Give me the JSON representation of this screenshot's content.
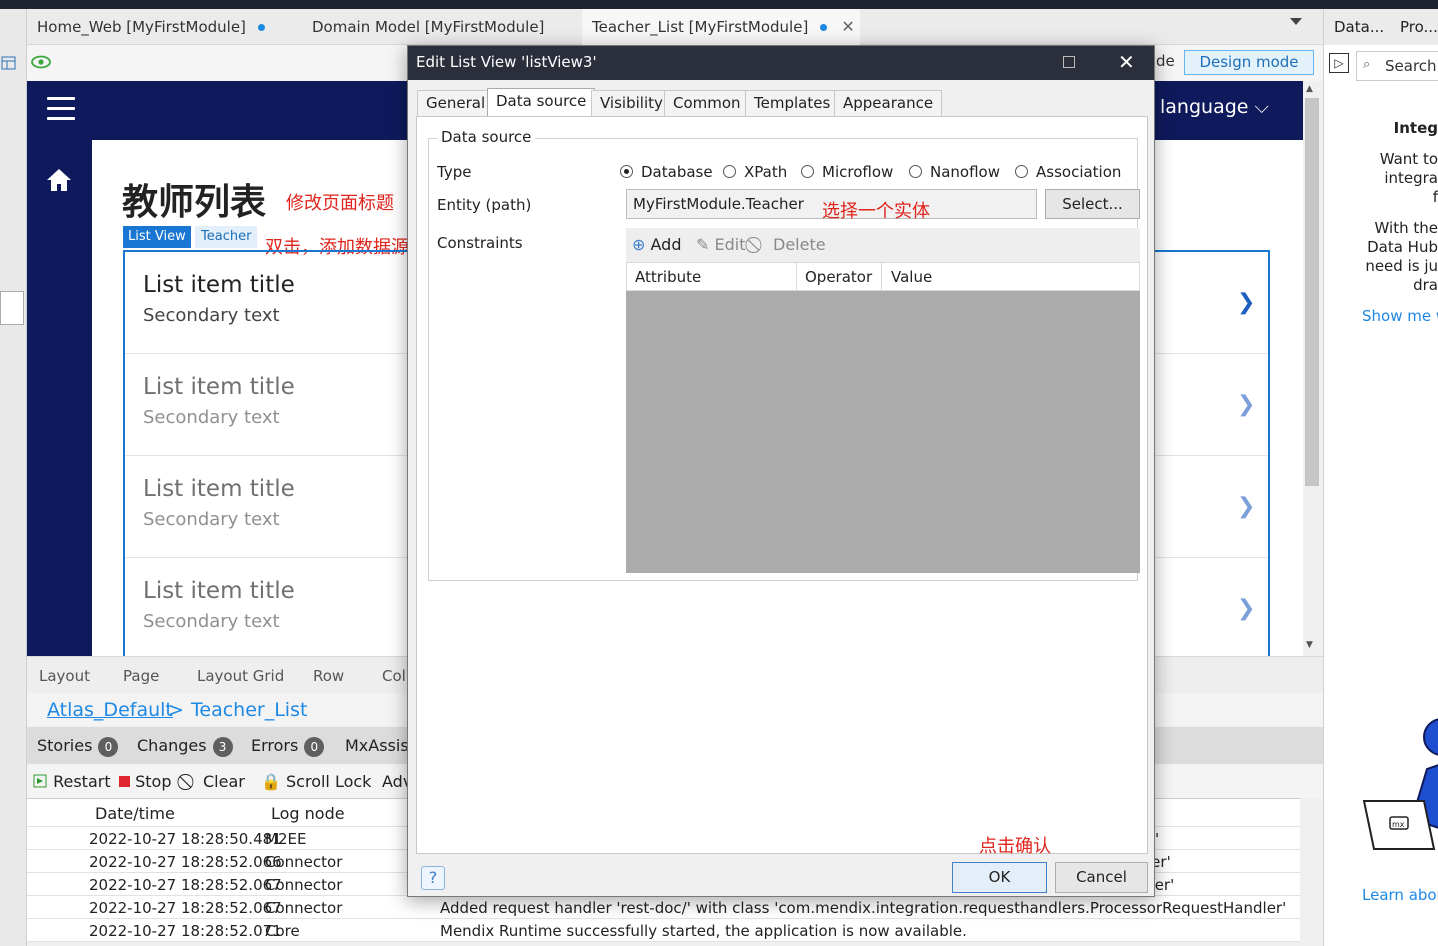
{
  "doc_tabs": [
    {
      "label": "Home_Web [MyFirstModule]",
      "unsaved": true
    },
    {
      "label": "Domain Model [MyFirstModule]",
      "unsaved": false
    },
    {
      "label": "Teacher_List [MyFirstModule]",
      "unsaved": true
    }
  ],
  "toolbar": {
    "structure_partial": "de",
    "design_mode": "Design mode"
  },
  "page": {
    "language_label": "language",
    "title": "教师列表",
    "listview_tag": "List View",
    "entity_tag": "Teacher",
    "items": [
      {
        "title": "List item title",
        "secondary": "Secondary text"
      },
      {
        "title": "List item title",
        "secondary": "Secondary text"
      },
      {
        "title": "List item title",
        "secondary": "Secondary text"
      },
      {
        "title": "List item title",
        "secondary": "Secondary text"
      }
    ]
  },
  "annotations": {
    "edit_title": "修改页面标题",
    "add_datasource": "双击，添加数据源",
    "choose_entity": "选择一个实体",
    "click_confirm": "点击确认"
  },
  "breadcrumb": [
    "Layout",
    "Page",
    "Layout Grid",
    "Row",
    "Col"
  ],
  "path": {
    "layout": "Atlas_Default",
    "separator": ">",
    "page": "Teacher_List"
  },
  "bottom_tabs": [
    {
      "label": "Stories",
      "count": "0"
    },
    {
      "label": "Changes",
      "count": "3"
    },
    {
      "label": "Errors",
      "count": "0"
    },
    {
      "label": "MxAssist",
      "count": ""
    }
  ],
  "console": {
    "restart": "Restart",
    "stop": "Stop",
    "clear": "Clear",
    "scroll_lock": "Scroll Lock",
    "advanced": "Adv"
  },
  "log": {
    "headers": [
      "Date/time",
      "Log node"
    ],
    "rows": [
      {
        "time": "2022-10-27 18:28:50.481",
        "node": "M2EE",
        "message": "'"
      },
      {
        "time": "2022-10-27 18:28:52.066",
        "node": "Connector",
        "message": "ler'"
      },
      {
        "time": "2022-10-27 18:28:52.067",
        "node": "Connector",
        "message": "dler'"
      },
      {
        "time": "2022-10-27 18:28:52.067",
        "node": "Connector",
        "message": "Added request handler 'rest-doc/' with class 'com.mendix.integration.requesthandlers.ProcessorRequestHandler'"
      },
      {
        "time": "2022-10-27 18:28:52.071",
        "node": "Core",
        "message": "Mendix Runtime successfully started, the application is now available."
      }
    ]
  },
  "right_panel": {
    "tabs": [
      "Data...",
      "Pro..."
    ],
    "search_placeholder": "Search...",
    "heading": "Integ",
    "lines1": [
      "Want to",
      "integra",
      "f"
    ],
    "lines2": [
      "With the",
      "Data Hub",
      "need is ju",
      "dra"
    ],
    "link": "Show me w",
    "learn": "Learn abou"
  },
  "dialog": {
    "title": "Edit List View 'listView3'",
    "tabs": [
      "General",
      "Data source",
      "Visibility",
      "Common",
      "Templates",
      "Appearance"
    ],
    "active_tab": "Data source",
    "group_title": "Data source",
    "type_label": "Type",
    "type_options": [
      "Database",
      "XPath",
      "Microflow",
      "Nanoflow",
      "Association"
    ],
    "type_selected": "Database",
    "entity_label": "Entity (path)",
    "entity_value": "MyFirstModule.Teacher",
    "select_button": "Select...",
    "constraints_label": "Constraints",
    "constraint_tools": [
      "Add",
      "Edit",
      "Delete"
    ],
    "constraint_columns": [
      "Attribute",
      "Operator",
      "Value"
    ],
    "ok": "OK",
    "cancel": "Cancel",
    "help": "?"
  },
  "colors": {
    "navy": "#0f1a5c",
    "accent": "#1976d2",
    "annotation_red": "#e0241b"
  }
}
